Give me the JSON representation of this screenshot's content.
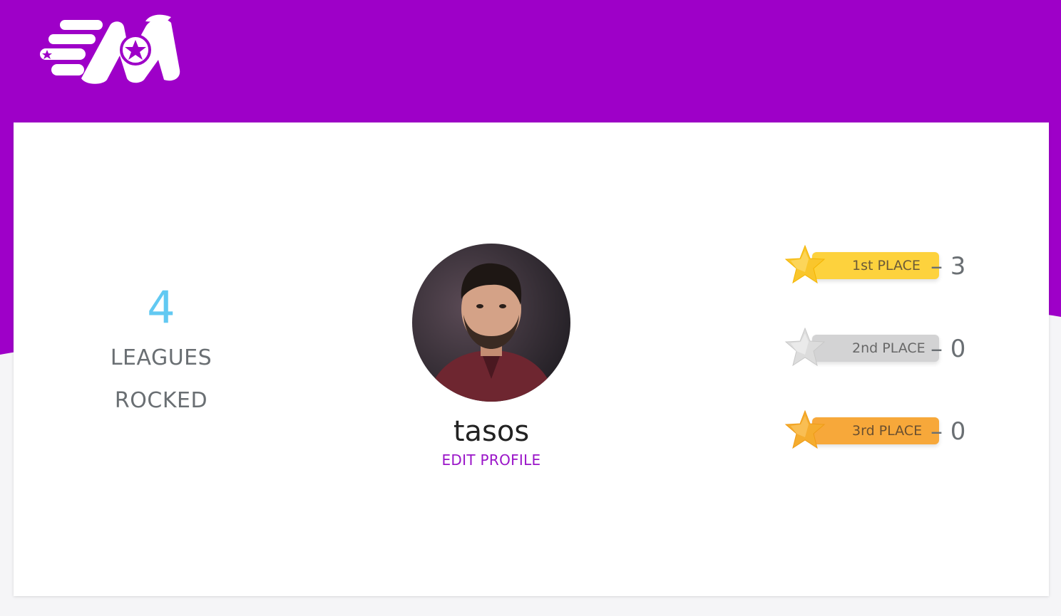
{
  "brand": {
    "logo_icon": "brand-logo-icon",
    "color_primary": "#9e00c8",
    "color_accent": "#62c9f2"
  },
  "stats": {
    "leagues_count": "4",
    "leagues_label_line1": "LEAGUES",
    "leagues_label_line2": "ROCKED"
  },
  "profile": {
    "username": "tasos",
    "edit_label": "EDIT PROFILE"
  },
  "placements": [
    {
      "label": "1st PLACE",
      "count": "– 3",
      "color": "#fdd23d"
    },
    {
      "label": "2nd PLACE",
      "count": "– 0",
      "color": "#d3d3d4"
    },
    {
      "label": "3rd PLACE",
      "count": "– 0",
      "color": "#f7a83a"
    }
  ]
}
